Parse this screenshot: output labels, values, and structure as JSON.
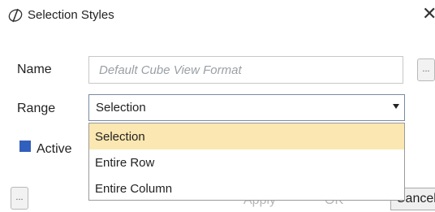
{
  "window": {
    "title": "Selection Styles",
    "close_glyph": "✕"
  },
  "icons": {
    "app": "app-logo-icon",
    "close": "close-icon",
    "dropdown_arrow": "chevron-down-icon"
  },
  "form": {
    "name_label": "Name",
    "name_value": "",
    "name_placeholder": "Default Cube View Format",
    "name_more_label": "...",
    "range_label": "Range",
    "range_value": "Selection",
    "range_options": [
      "Selection",
      "Entire Row",
      "Entire Column"
    ],
    "range_highlighted": "Selection",
    "active_label": "Active",
    "active_checked": true
  },
  "footer": {
    "more_label": "...",
    "apply_label": "Apply",
    "ok_label": "OK",
    "cancel_label": "Cancel"
  },
  "colors": {
    "highlight": "#fbe7b1",
    "checkbox": "#2f5fbf"
  }
}
